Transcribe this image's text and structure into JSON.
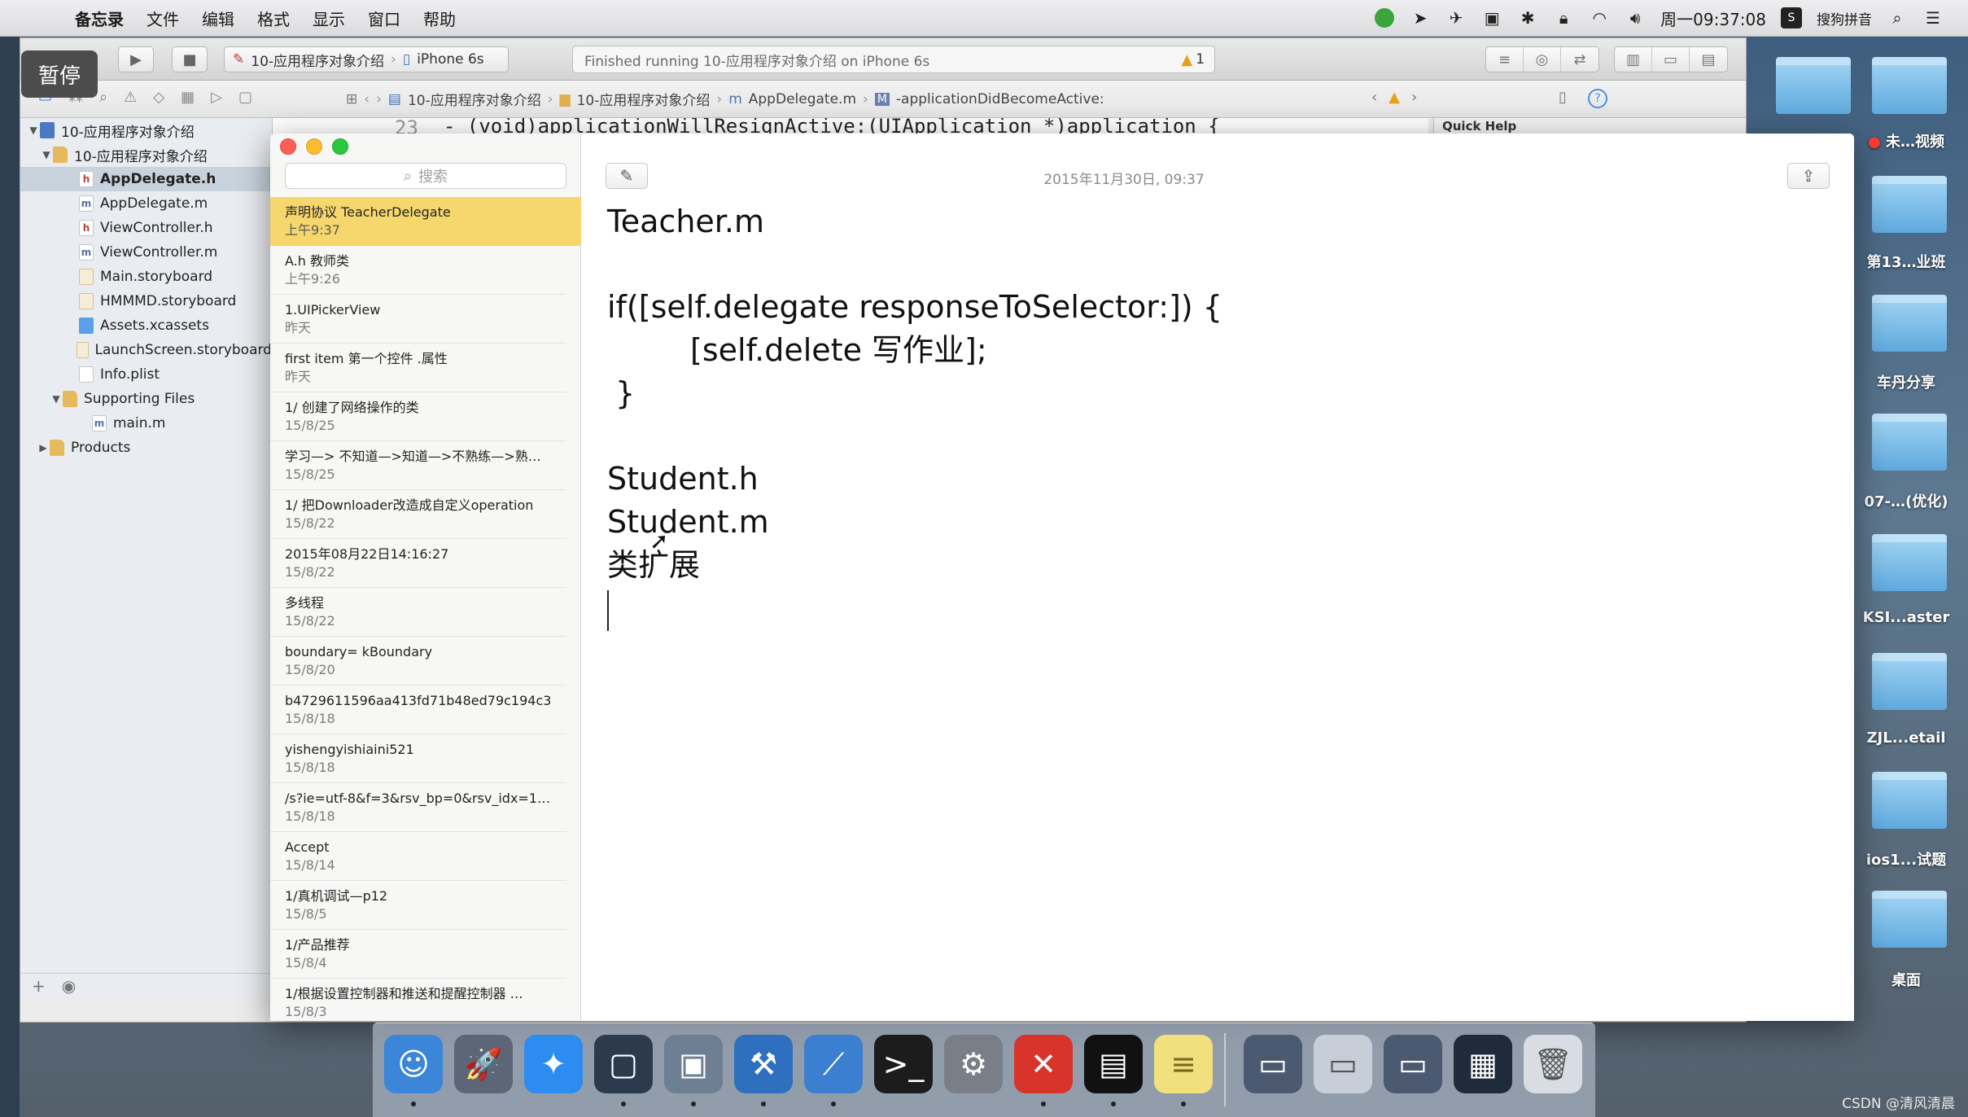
{
  "menubar": {
    "apple": "",
    "app_name": "备忘录",
    "menus": [
      "文件",
      "编辑",
      "格式",
      "显示",
      "窗口",
      "帮助"
    ],
    "clock": "周一09:37:08",
    "input_method": "搜狗拼音"
  },
  "pause_badge": "暂停",
  "xcode": {
    "scheme": "10-应用程序对象介绍",
    "device": "iPhone 6s",
    "activity": "Finished running 10-应用程序对象介绍 on iPhone 6s",
    "warning_count": "1",
    "jumpbar": [
      "10-应用程序对象介绍",
      "10-应用程序对象介绍",
      "AppDelegate.m",
      "-applicationDidBecomeActive:"
    ],
    "quick_help_title": "Quick Help",
    "editor_line_number": "23",
    "editor_line": "- (void)applicationWillResignActive:(UIApplication *)application {",
    "tree": [
      {
        "label": "10-应用程序对象介绍",
        "icon": "project-icon"
      },
      {
        "label": "10-应用程序对象介绍",
        "icon": "folder-icon"
      },
      {
        "label": "AppDelegate.h",
        "icon": "h-file-icon",
        "selected": true
      },
      {
        "label": "AppDelegate.m",
        "icon": "m-file-icon"
      },
      {
        "label": "ViewController.h",
        "icon": "h-file-icon"
      },
      {
        "label": "ViewController.m",
        "icon": "m-file-icon"
      },
      {
        "label": "Main.storyboard",
        "icon": "storyboard-icon"
      },
      {
        "label": "HMMMD.storyboard",
        "icon": "storyboard-icon"
      },
      {
        "label": "Assets.xcassets",
        "icon": "assets-icon"
      },
      {
        "label": "LaunchScreen.storyboard",
        "icon": "storyboard-icon"
      },
      {
        "label": "Info.plist",
        "icon": "plist-icon"
      },
      {
        "label": "Supporting Files",
        "icon": "folder-icon"
      },
      {
        "label": "main.m",
        "icon": "m-file-icon"
      },
      {
        "label": "Products",
        "icon": "folder-icon"
      }
    ]
  },
  "notes": {
    "search_placeholder": "搜索",
    "items": [
      {
        "title": "声明协议 TeacherDelegate",
        "date": "上午9:37",
        "selected": true
      },
      {
        "title": "A.h 教师类",
        "date": "上午9:26"
      },
      {
        "title": "1.UIPickerView",
        "date": "昨天"
      },
      {
        "title": "first item 第一个控件 .属性",
        "date": "昨天"
      },
      {
        "title": "1/ 创建了网络操作的类",
        "date": "15/8/25"
      },
      {
        "title": "学习—> 不知道—>知道—>不熟练—>熟…",
        "date": "15/8/25"
      },
      {
        "title": "1/ 把Downloader改造成自定义operation",
        "date": "15/8/22"
      },
      {
        "title": "2015年08月22日14:16:27",
        "date": "15/8/22"
      },
      {
        "title": "多线程",
        "date": "15/8/22"
      },
      {
        "title": "boundary= kBoundary",
        "date": "15/8/20"
      },
      {
        "title": "b4729611596aa413fd71b48ed79c194c3",
        "date": "15/8/18"
      },
      {
        "title": "yishengyishiaini521",
        "date": "15/8/18"
      },
      {
        "title": "/s?ie=utf-8&f=3&rsv_bp=0&rsv_idx=1…",
        "date": "15/8/18"
      },
      {
        "title": "Accept",
        "date": "15/8/14"
      },
      {
        "title": "1/真机调试—p12",
        "date": "15/8/5"
      },
      {
        "title": "1/产品推荐",
        "date": "15/8/4"
      },
      {
        "title": "1/根据设置控制器和推送和提醒控制器 …",
        "date": "15/8/3"
      }
    ],
    "current_date": "2015年11月30日, 09:37",
    "body": {
      "line1": "Teacher.m",
      "line2": "if([self.delegate responseToSelector:]) {",
      "line3": "[self.delete 写作业];",
      "line4": "}",
      "line5": "Student.h",
      "line6": "Student.m",
      "line7": "类扩展"
    }
  },
  "desktop_folders": [
    {
      "label": "",
      "icon": "folder-icon"
    },
    {
      "label": "未…视频",
      "icon": "folder-icon",
      "recording": true
    },
    {
      "label": "第13…业班",
      "icon": "folder-icon"
    },
    {
      "label": "车丹分享",
      "icon": "folder-icon"
    },
    {
      "label": "07-…(优化)",
      "icon": "folder-icon"
    },
    {
      "label": "KSI...aster",
      "icon": "folder-icon"
    },
    {
      "label": "ZJL...etail",
      "icon": "folder-icon"
    },
    {
      "label": "ios1...试题",
      "icon": "folder-icon"
    },
    {
      "label": "桌面",
      "icon": "folder-icon"
    }
  ],
  "dock": [
    {
      "name": "finder-icon",
      "color": "#3b86d8",
      "glyph": "☺"
    },
    {
      "name": "launchpad-icon",
      "color": "#5c6677",
      "glyph": "🚀"
    },
    {
      "name": "safari-icon",
      "color": "#2d8cf0",
      "glyph": "✦"
    },
    {
      "name": "mouse-icon",
      "color": "#2c3a4d",
      "glyph": "▢"
    },
    {
      "name": "movie-icon",
      "color": "#6e7e93",
      "glyph": "▣"
    },
    {
      "name": "xcode-icon",
      "color": "#2f6fc0",
      "glyph": "⚒"
    },
    {
      "name": "instruments-icon",
      "color": "#3a7fd0",
      "glyph": "⟋"
    },
    {
      "name": "terminal-icon",
      "color": "#1c1c1c",
      "glyph": ">_"
    },
    {
      "name": "system-preferences-icon",
      "color": "#7a7f87",
      "glyph": "⚙"
    },
    {
      "name": "xmind-icon",
      "color": "#d9342b",
      "glyph": "✕"
    },
    {
      "name": "console-icon",
      "color": "#111111",
      "glyph": "▤"
    },
    {
      "name": "notes-icon",
      "color": "#f1e07d",
      "glyph": "≡"
    },
    {
      "name": "screen-share-icon",
      "color": "#4b5a70",
      "glyph": "▭"
    },
    {
      "name": "preview-icon",
      "color": "#c7ced8",
      "glyph": "▭"
    },
    {
      "name": "remote-desktop-icon",
      "color": "#4b5a70",
      "glyph": "▭"
    },
    {
      "name": "calculator-icon",
      "color": "#1f2a3a",
      "glyph": "▦"
    },
    {
      "name": "trash-icon",
      "color": "#d8dde3",
      "glyph": "🗑"
    }
  ],
  "watermark": "CSDN @清风清晨"
}
